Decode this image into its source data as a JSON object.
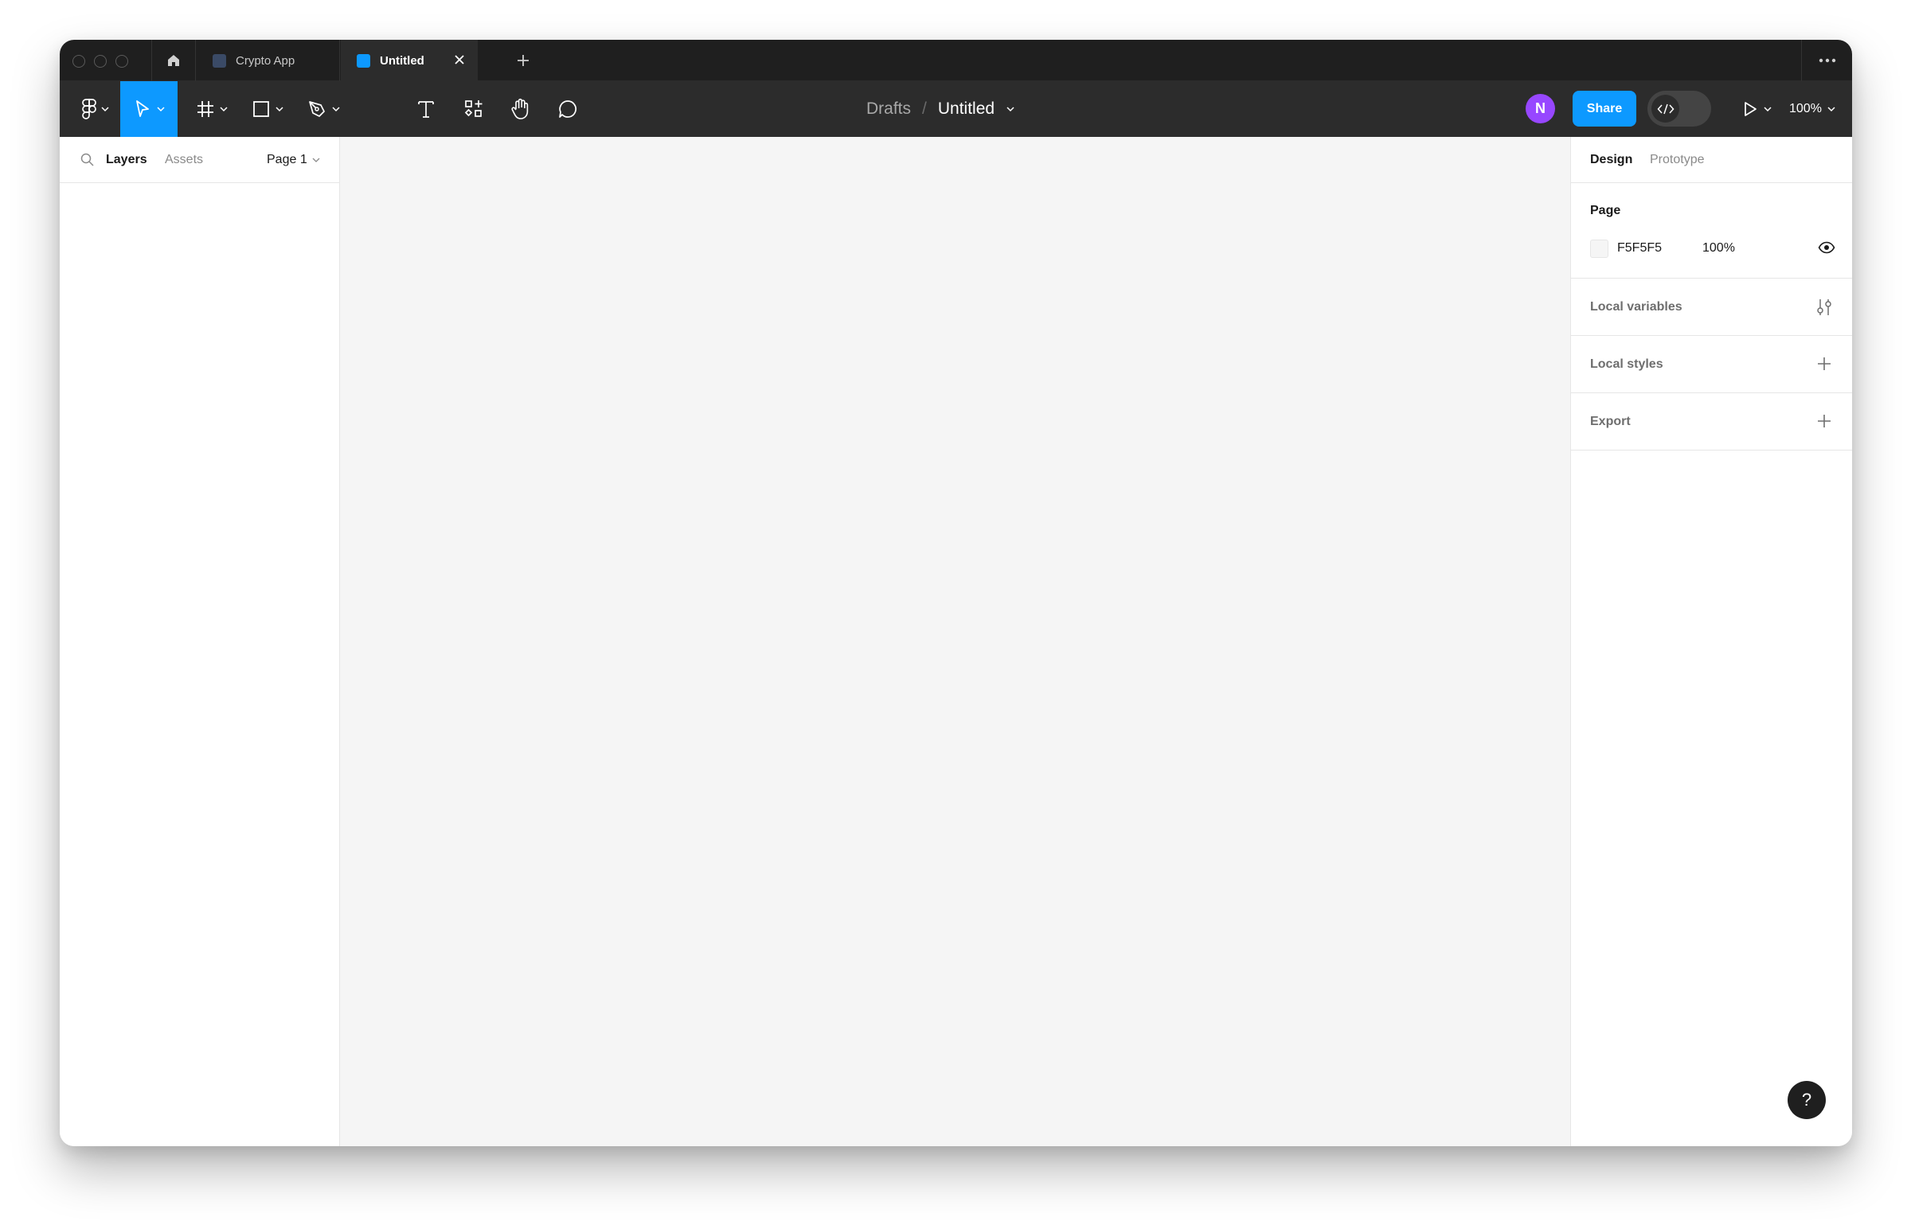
{
  "tabbar": {
    "tabs": [
      {
        "label": "Crypto App",
        "active": false
      },
      {
        "label": "Untitled",
        "active": true
      }
    ],
    "new_tab_icon": "plus-icon",
    "more_icon": "more-horizontal-icon"
  },
  "toolbar": {
    "tools": [
      {
        "name": "main-menu",
        "icon": "figma-logo-icon"
      },
      {
        "name": "move",
        "icon": "cursor-arrow-icon",
        "active": true
      },
      {
        "name": "frame",
        "icon": "hash-frame-icon"
      },
      {
        "name": "shape",
        "icon": "rectangle-icon"
      },
      {
        "name": "pen",
        "icon": "pen-nib-icon"
      },
      {
        "name": "text",
        "icon": "text-icon"
      },
      {
        "name": "resources",
        "icon": "components-icon"
      },
      {
        "name": "hand",
        "icon": "hand-icon"
      },
      {
        "name": "comment",
        "icon": "comment-icon"
      }
    ],
    "breadcrumb": {
      "parent": "Drafts",
      "separator": "/",
      "file": "Untitled"
    },
    "avatar_initial": "N",
    "share_label": "Share",
    "zoom": "100%",
    "accent": "#0d99ff",
    "avatar_color": "#9747ff"
  },
  "left_panel": {
    "tabs": {
      "layers": "Layers",
      "assets": "Assets"
    },
    "page_selector": "Page 1"
  },
  "right_panel": {
    "tabs": {
      "design": "Design",
      "prototype": "Prototype"
    },
    "page": {
      "label": "Page",
      "color_hex": "F5F5F5",
      "opacity": "100%"
    },
    "sections": [
      {
        "label": "Local variables",
        "icon": "sliders-icon"
      },
      {
        "label": "Local styles",
        "icon": "plus-icon"
      },
      {
        "label": "Export",
        "icon": "plus-icon"
      }
    ]
  },
  "help": {
    "label": "?"
  }
}
